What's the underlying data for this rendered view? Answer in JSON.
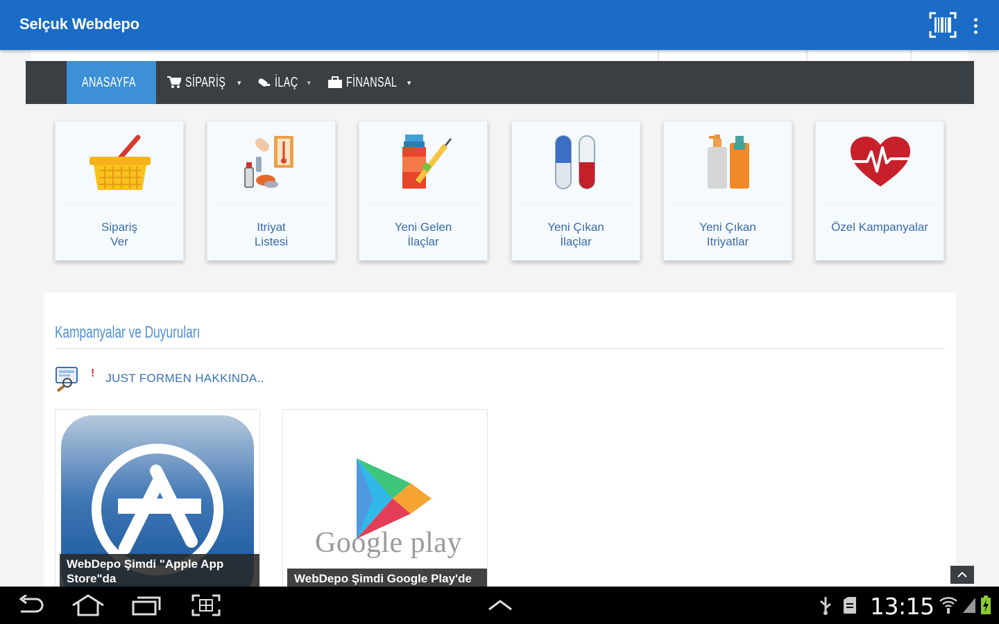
{
  "app": {
    "title": "Selçuk Webdepo"
  },
  "nav": [
    {
      "label": "ANASAYFA",
      "icon": "home-icon",
      "active": true
    },
    {
      "label": "SİPARİŞ",
      "icon": "cart-icon",
      "caret": "▾"
    },
    {
      "label": "İLAÇ",
      "icon": "pill-icon",
      "caret": "▾"
    },
    {
      "label": "FİNANSAL",
      "icon": "briefcase-icon",
      "caret": "▾"
    }
  ],
  "tiles": [
    {
      "label": "Sipariş\nVer",
      "icon": "basket-icon"
    },
    {
      "label": "Itriyat\nListesi",
      "icon": "cosmetics-icon"
    },
    {
      "label": "Yeni Gelen\nİlaçlar",
      "icon": "medicine-bottle-icon"
    },
    {
      "label": "Yeni Çıkan\nİlaçlar",
      "icon": "test-tubes-icon"
    },
    {
      "label": "Yeni Çıkan\nItriyatlar",
      "icon": "lotion-bottles-icon"
    },
    {
      "label": "Özel Kampanyalar",
      "icon": "heartbeat-icon"
    }
  ],
  "announcements": {
    "heading": "Kampanyalar ve Duyuruları",
    "news_marker": "!",
    "news_item": "JUST FORMEN HAKKINDA..",
    "cards": [
      {
        "caption": "WebDepo Şimdi \"Apple App Store\"da",
        "icon": "app-store-icon"
      },
      {
        "caption": "WebDepo Şimdi Google Play'de",
        "icon": "google-play-icon",
        "logo_text": "Google play"
      }
    ]
  },
  "status": {
    "time": "13:15"
  },
  "colors": {
    "appbar": "#1a6cc6",
    "navbar": "#3a3f44",
    "nav_active": "#3d8fd6",
    "link": "#3c6aa8"
  }
}
